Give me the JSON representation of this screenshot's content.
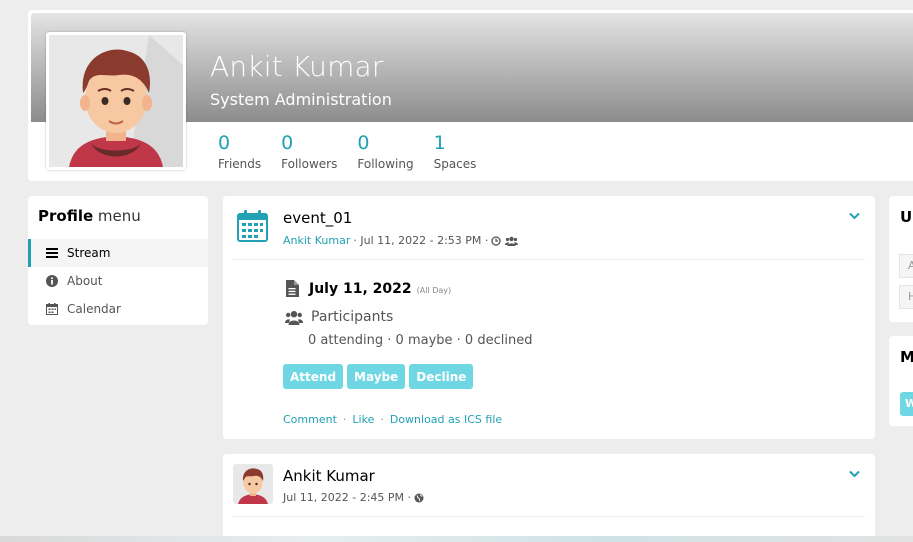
{
  "profile": {
    "name": "Ankit Kumar",
    "subtitle": "System Administration",
    "stats": [
      {
        "value": "0",
        "label": "Friends"
      },
      {
        "value": "0",
        "label": "Followers"
      },
      {
        "value": "0",
        "label": "Following"
      },
      {
        "value": "1",
        "label": "Spaces"
      }
    ]
  },
  "menu": {
    "title_bold": "Profile",
    "title_rest": "menu",
    "items": [
      {
        "label": "Stream",
        "icon": "bars-icon",
        "active": true
      },
      {
        "label": "About",
        "icon": "info-circle-icon",
        "active": false
      },
      {
        "label": "Calendar",
        "icon": "calendar-icon",
        "active": false
      }
    ]
  },
  "event": {
    "title": "event_01",
    "author": "Ankit Kumar",
    "meta": "· Jul 11, 2022 - 2:53 PM ·",
    "date": "July 11, 2022",
    "all_day": "(All Day)",
    "participants_label": "Participants",
    "counts": "0 attending · 0 maybe · 0 declined",
    "buttons": [
      "Attend",
      "Maybe",
      "Decline"
    ],
    "actions": [
      "Comment",
      "Like",
      "Download as ICS file"
    ]
  },
  "post": {
    "author": "Ankit Kumar",
    "meta": "Jul 11, 2022 - 2:45 PM ·"
  },
  "side": {
    "card1_title": "U",
    "card1_rows": [
      "A",
      "H"
    ],
    "card2_title": "M",
    "card2_button": "W"
  },
  "colors": {
    "accent": "#21a1b3",
    "button": "#6fd7e4",
    "background": "#ededed"
  }
}
